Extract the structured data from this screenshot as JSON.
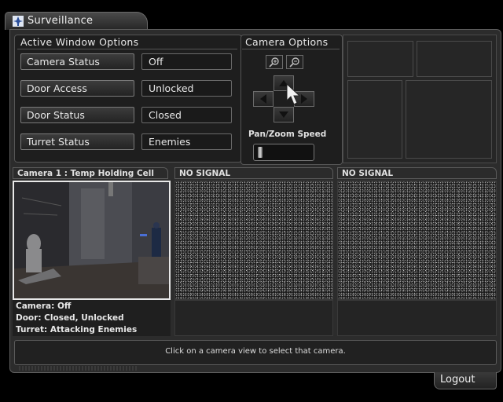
{
  "window": {
    "title": "Surveillance",
    "icon": "windmill-logo-icon"
  },
  "active_window_options": {
    "title": "Active Window Options",
    "rows": [
      {
        "label": "Camera Status",
        "value": "Off"
      },
      {
        "label": "Door Access",
        "value": "Unlocked"
      },
      {
        "label": "Door Status",
        "value": "Closed"
      },
      {
        "label": "Turret Status",
        "value": "Enemies"
      }
    ]
  },
  "camera_options": {
    "title": "Camera Options",
    "zoom_in_icon": "zoom-in-icon",
    "zoom_out_icon": "zoom-out-icon",
    "speed_label": "Pan/Zoom Speed"
  },
  "cameras": [
    {
      "header": "Camera 1 : Temp Holding Cell",
      "active": true
    },
    {
      "header": "NO SIGNAL",
      "active": false
    },
    {
      "header": "NO SIGNAL",
      "active": false
    }
  ],
  "camera_info": {
    "line1": "Camera: Off",
    "line2": "Door: Closed, Unlocked",
    "line3": "Turret: Attacking Enemies"
  },
  "status_bar": {
    "message": "Click on a camera view to select that camera."
  },
  "logout_label": "Logout"
}
